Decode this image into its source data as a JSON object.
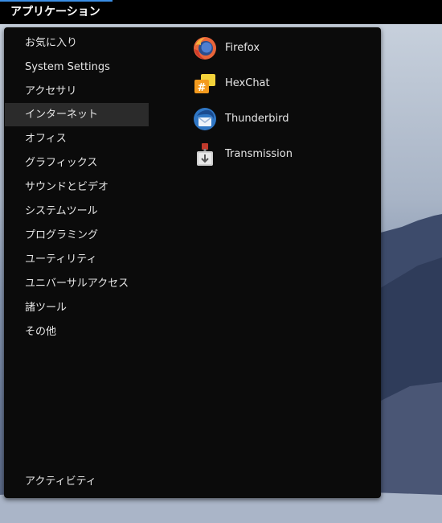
{
  "top_bar": {
    "applications_label": "アプリケーション"
  },
  "menu": {
    "categories": [
      {
        "label": "お気に入り",
        "selected": false
      },
      {
        "label": "System Settings",
        "selected": false
      },
      {
        "label": "アクセサリ",
        "selected": false
      },
      {
        "label": "インターネット",
        "selected": true
      },
      {
        "label": "オフィス",
        "selected": false
      },
      {
        "label": "グラフィックス",
        "selected": false
      },
      {
        "label": "サウンドとビデオ",
        "selected": false
      },
      {
        "label": "システムツール",
        "selected": false
      },
      {
        "label": "プログラミング",
        "selected": false
      },
      {
        "label": "ユーティリティ",
        "selected": false
      },
      {
        "label": "ユニバーサルアクセス",
        "selected": false
      },
      {
        "label": "諸ツール",
        "selected": false
      },
      {
        "label": "その他",
        "selected": false
      }
    ],
    "activities_label": "アクティビティ",
    "apps": [
      {
        "label": "Firefox",
        "icon": "firefox-icon"
      },
      {
        "label": "HexChat",
        "icon": "hexchat-icon"
      },
      {
        "label": "Thunderbird",
        "icon": "thunderbird-icon"
      },
      {
        "label": "Transmission",
        "icon": "transmission-icon"
      }
    ]
  },
  "colors": {
    "accent": "#3a8ee6",
    "menu_bg": "#0b0b0b",
    "selected_bg": "#2b2b2b"
  }
}
